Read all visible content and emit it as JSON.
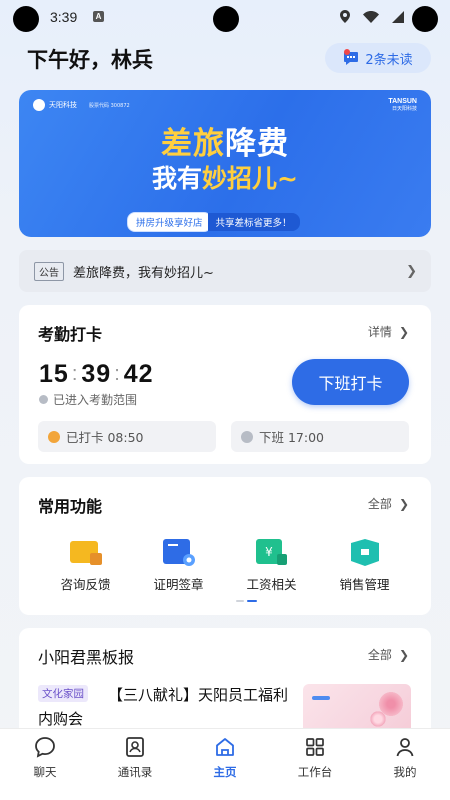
{
  "status_bar": {
    "time": "3:39",
    "notification_glyph": "A",
    "icons": [
      "location-icon",
      "wifi-icon",
      "signal-icon"
    ]
  },
  "header": {
    "greeting": "下午好，林兵",
    "messages_label": "2条未读"
  },
  "banner": {
    "company_short": "天阳科技",
    "company_sub": "股票代码 300872",
    "brand": "TANSUN",
    "brand_sub": "日天阳科技",
    "title_part1": "差旅",
    "title_part2": "降费",
    "title2_part1": "我有",
    "title2_part2": "妙招儿~",
    "chip1": "拼房升级享好店",
    "chip2": "共享差标省更多！"
  },
  "notice": {
    "tag": "公告",
    "text": "差旅降费，我有妙招儿~"
  },
  "attendance": {
    "title": "考勤打卡",
    "detail_link": "详情",
    "clock_h": "15",
    "clock_m": "39",
    "clock_s": "42",
    "range_status": "已进入考勤范围",
    "punch_button": "下班打卡",
    "clocked_in": "已打卡 08:50",
    "clock_out": "下班 17:00"
  },
  "functions": {
    "title": "常用功能",
    "all_link": "全部",
    "items": [
      {
        "label": "咨询反馈",
        "icon": "feedback-icon"
      },
      {
        "label": "证明签章",
        "icon": "certificate-icon"
      },
      {
        "label": "工资相关",
        "icon": "salary-icon"
      },
      {
        "label": "销售管理",
        "icon": "sales-icon"
      }
    ]
  },
  "board": {
    "title": "小阳君黑板报",
    "all_link": "全部",
    "article_tag": "文化家园",
    "article_title": "【三八献礼】天阳员工福利内购会"
  },
  "tabbar": {
    "tabs": [
      {
        "label": "聊天",
        "icon": "chat-icon"
      },
      {
        "label": "通讯录",
        "icon": "contacts-icon"
      },
      {
        "label": "主页",
        "icon": "home-icon",
        "active": true
      },
      {
        "label": "工作台",
        "icon": "workbench-icon"
      },
      {
        "label": "我的",
        "icon": "profile-icon"
      }
    ]
  },
  "colors": {
    "accent": "#2e6ce6",
    "banner_highlight": "#ffcf3f",
    "salary_green": "#20c08e",
    "feedback_yellow": "#f5b820"
  }
}
